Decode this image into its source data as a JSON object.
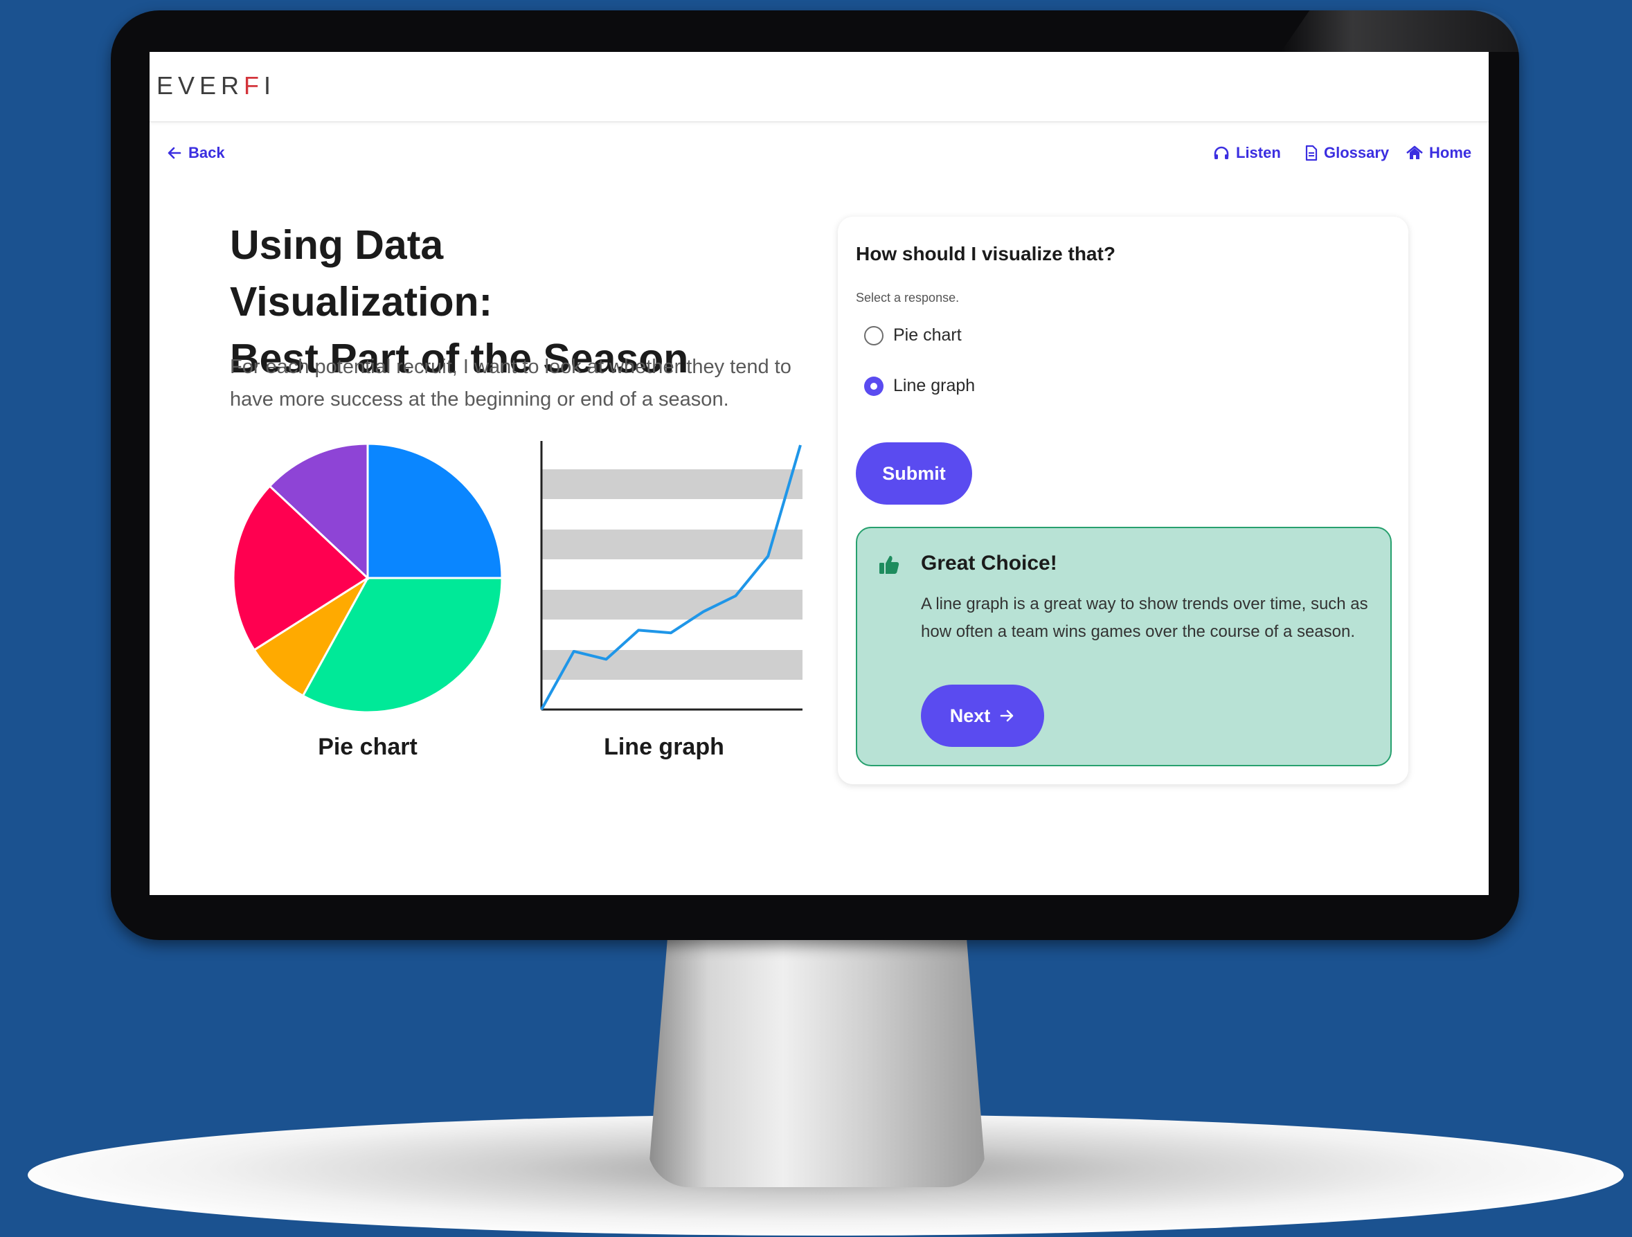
{
  "header": {
    "logo_text_start": "EVER",
    "logo_text_mid": "F",
    "logo_text_end": "I",
    "logo_accent_color": "#d3343b"
  },
  "nav": {
    "back_label": "Back",
    "listen_label": "Listen",
    "glossary_label": "Glossary",
    "home_label": "Home",
    "link_color": "#3b2ee0"
  },
  "main": {
    "title_line1": "Using Data Visualization:",
    "title_line2": "Best Part of the Season",
    "intro": "For each potential recruit, I want to look at whether they tend to have more success at the beginning or end of a season.",
    "pie_caption": "Pie chart",
    "line_caption": "Line graph"
  },
  "chart_data": [
    {
      "type": "pie",
      "slices": [
        {
          "fraction": 0.25,
          "color": "#0a86ff"
        },
        {
          "fraction": 0.33,
          "color": "#00e998"
        },
        {
          "fraction": 0.08,
          "color": "#ffaa00"
        },
        {
          "fraction": 0.21,
          "color": "#ff0050"
        },
        {
          "fraction": 0.13,
          "color": "#8e44d6"
        }
      ]
    },
    {
      "type": "line",
      "x": [
        0,
        1,
        2,
        3,
        4,
        5,
        6,
        7,
        8
      ],
      "y": [
        0,
        22,
        19,
        30,
        29,
        37,
        43,
        58,
        100
      ],
      "ylim": [
        0,
        100
      ],
      "grid": "horizontal bands",
      "line_color": "#1f96e8",
      "band_color": "#cfcfcf"
    }
  ],
  "question": {
    "title": "How should I visualize that?",
    "hint": "Select a response.",
    "options": [
      {
        "label": "Pie chart",
        "selected": false
      },
      {
        "label": "Line graph",
        "selected": true
      }
    ],
    "submit_label": "Submit",
    "accent_color": "#5a4bf0"
  },
  "feedback": {
    "title": "Great Choice!",
    "body": "A line graph is a great way to show trends over time, such as how often a team wins games over the course of a season.",
    "next_label": "Next",
    "background": "#b8e2d5",
    "border_color": "#27a06e",
    "icon": "thumbs-up-icon"
  }
}
